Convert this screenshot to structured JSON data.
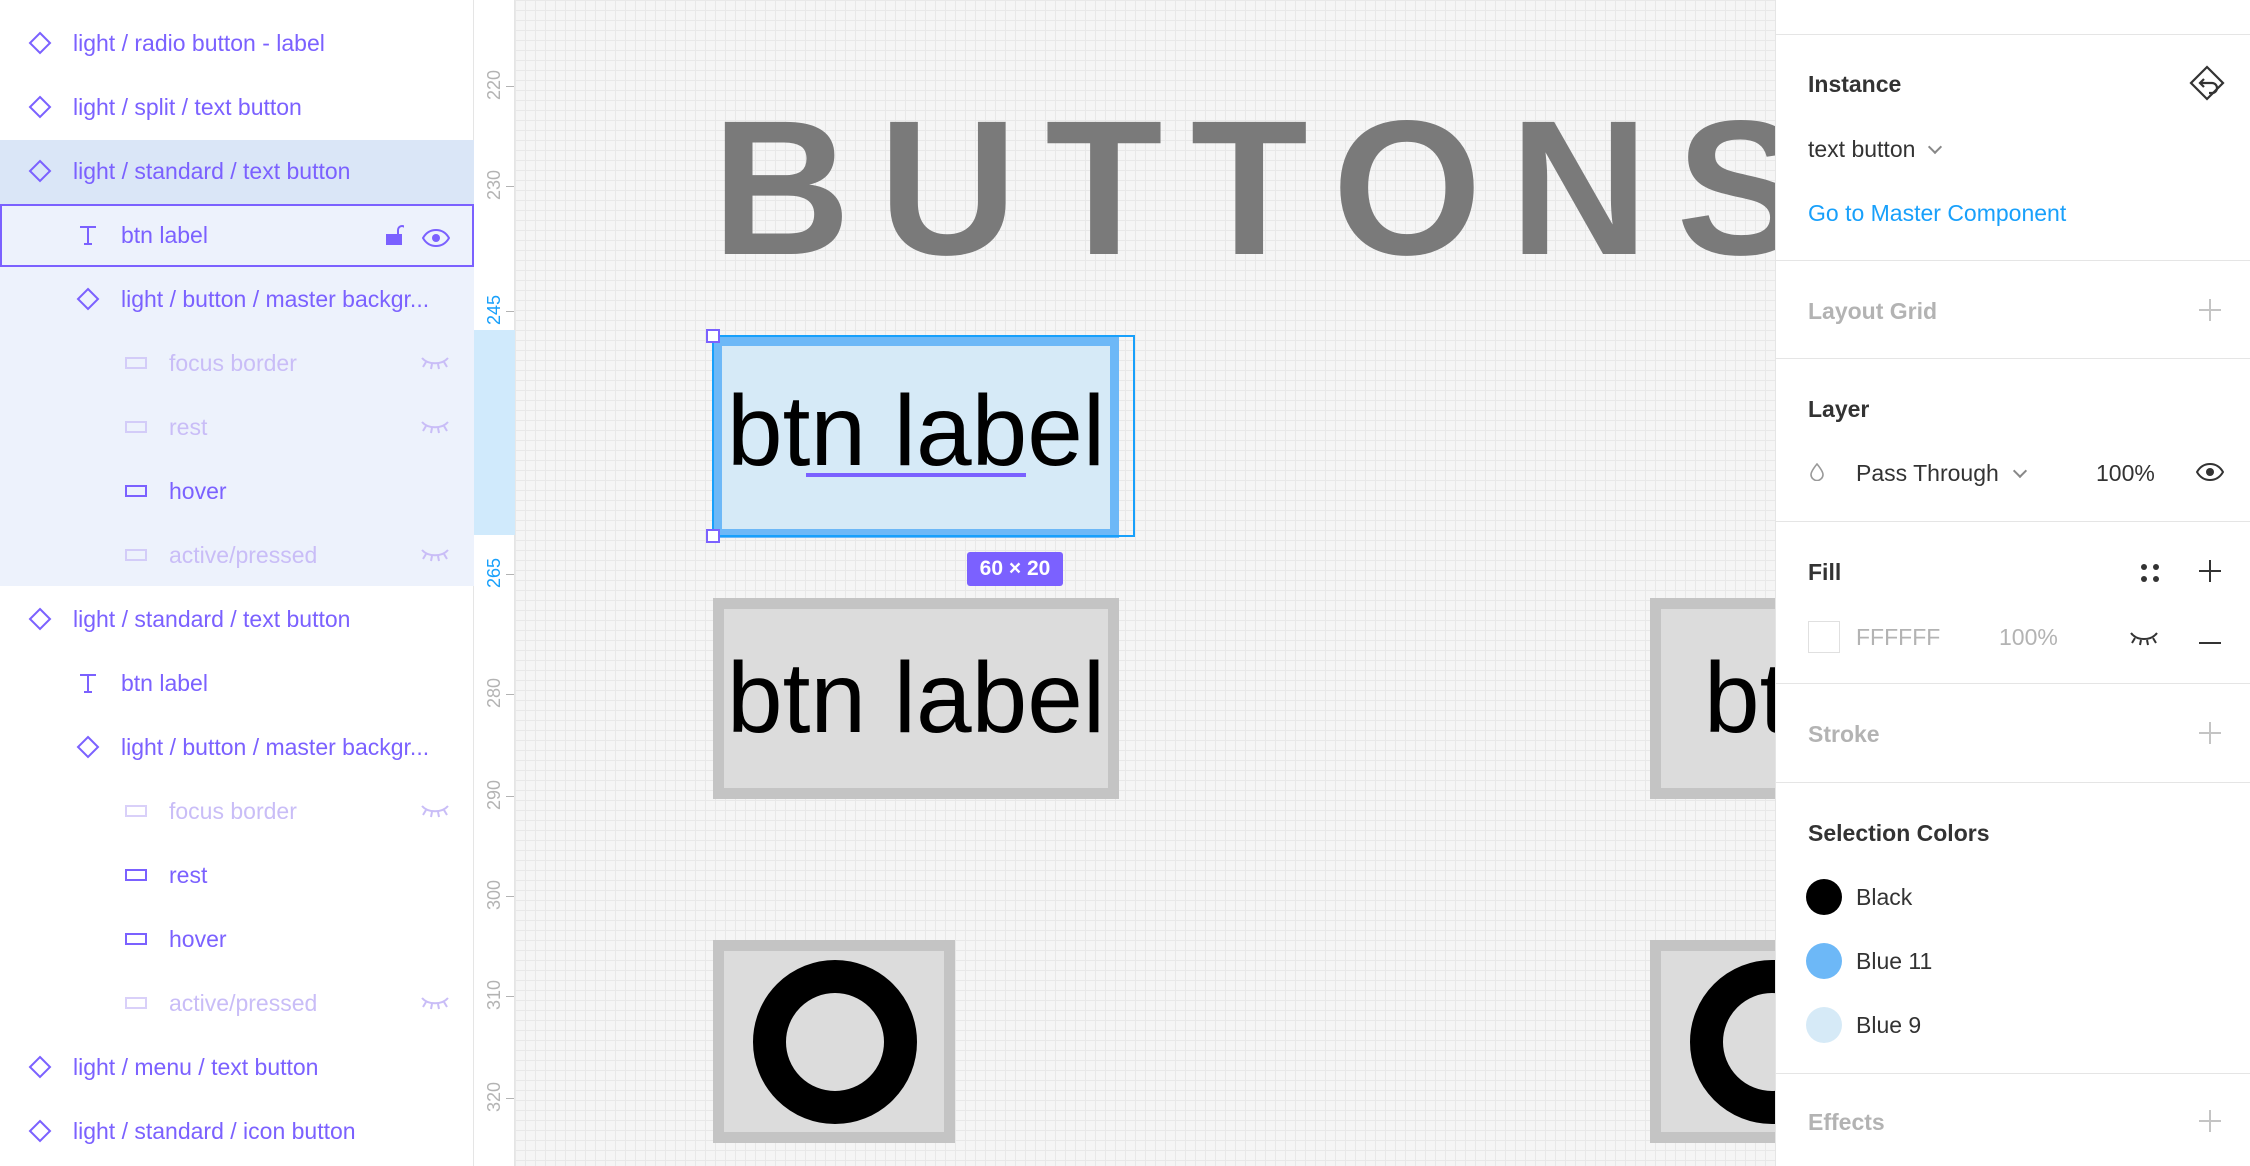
{
  "layers": [
    {
      "label": "light / radio button - label",
      "icon": "component-icon",
      "indent": 0,
      "dim": false
    },
    {
      "label": "light / split / text button",
      "icon": "component-icon",
      "indent": 0,
      "dim": false
    },
    {
      "label": "light / standard / text button",
      "icon": "component-icon",
      "indent": 0,
      "dim": false
    },
    {
      "label": "btn label",
      "icon": "text-icon",
      "indent": 1,
      "dim": false
    },
    {
      "label": "light / button / master backgr...",
      "icon": "component-icon",
      "indent": 1,
      "dim": false
    },
    {
      "label": "focus border",
      "icon": "rectangle-icon",
      "indent": 2,
      "dim": true
    },
    {
      "label": "rest",
      "icon": "rectangle-icon",
      "indent": 2,
      "dim": true
    },
    {
      "label": "hover",
      "icon": "rectangle-icon",
      "indent": 2,
      "dim": false
    },
    {
      "label": "active/pressed",
      "icon": "rectangle-icon",
      "indent": 2,
      "dim": true
    },
    {
      "label": "light / standard / text button",
      "icon": "component-icon",
      "indent": 0,
      "dim": false
    },
    {
      "label": "btn label",
      "icon": "text-icon",
      "indent": 1,
      "dim": false
    },
    {
      "label": "light / button / master backgr...",
      "icon": "component-icon",
      "indent": 1,
      "dim": false
    },
    {
      "label": "focus border",
      "icon": "rectangle-icon",
      "indent": 2,
      "dim": true
    },
    {
      "label": "rest",
      "icon": "rectangle-icon",
      "indent": 2,
      "dim": false
    },
    {
      "label": "hover",
      "icon": "rectangle-icon",
      "indent": 2,
      "dim": false
    },
    {
      "label": "active/pressed",
      "icon": "rectangle-icon",
      "indent": 2,
      "dim": true
    },
    {
      "label": "light / menu / text button",
      "icon": "component-icon",
      "indent": 0,
      "dim": false
    },
    {
      "label": "light / standard / icon button",
      "icon": "component-icon",
      "indent": 0,
      "dim": false
    }
  ],
  "ruler": {
    "labels": [
      "220",
      "230",
      "245",
      "265",
      "280",
      "290",
      "300",
      "310",
      "320"
    ]
  },
  "canvas": {
    "heading": "BUTTONS",
    "selected_button_label": "btn label",
    "button_label": "btn label",
    "partial_button_label": "bt",
    "size_badge": "60 × 20"
  },
  "props": {
    "instance": {
      "title": "Instance",
      "component": "text button",
      "link": "Go to Master Component"
    },
    "layout_grid": {
      "title": "Layout Grid"
    },
    "layer": {
      "title": "Layer",
      "blend": "Pass Through",
      "opacity": "100%"
    },
    "fill": {
      "title": "Fill",
      "hex": "FFFFFF",
      "opacity": "100%"
    },
    "stroke": {
      "title": "Stroke"
    },
    "selection_colors": {
      "title": "Selection Colors",
      "items": [
        {
          "name": "Black",
          "color": "#000000"
        },
        {
          "name": "Blue 11",
          "color": "#6db8f7"
        },
        {
          "name": "Blue 9",
          "color": "#d6eaf7"
        }
      ]
    },
    "effects": {
      "title": "Effects"
    }
  },
  "colors": {
    "accent": "#7b61ff",
    "selection": "#18a0fb"
  }
}
